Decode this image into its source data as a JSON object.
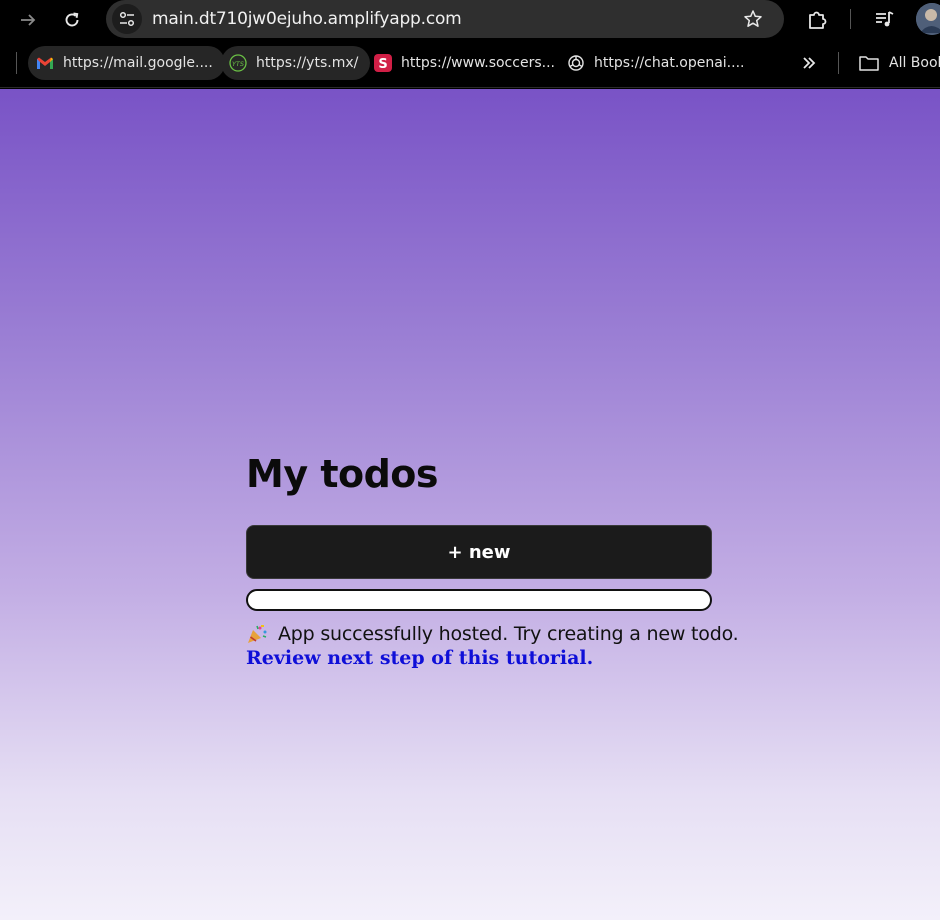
{
  "browser": {
    "url": "main.dt710jw0ejuho.amplifyapp.com",
    "bookmarks": [
      {
        "label": "https://mail.google....",
        "icon": "gmail-icon"
      },
      {
        "label": "https://yts.mx/",
        "icon": "yts-icon"
      },
      {
        "label": "https://www.soccers...",
        "icon": "soccer-s-icon"
      },
      {
        "label": "https://chat.openai....",
        "icon": "openai-icon"
      }
    ],
    "all_bookmarks": "All Book"
  },
  "page": {
    "title": "My todos",
    "new_button": "+ new",
    "message": "App successfully hosted. Try creating a new todo.",
    "link": "Review next step of this tutorial."
  },
  "colors": {
    "gradient_top": "#7953c6",
    "gradient_bottom": "#f3f0fa",
    "button_bg": "#1b1b1b",
    "link": "#0f0fd8"
  }
}
